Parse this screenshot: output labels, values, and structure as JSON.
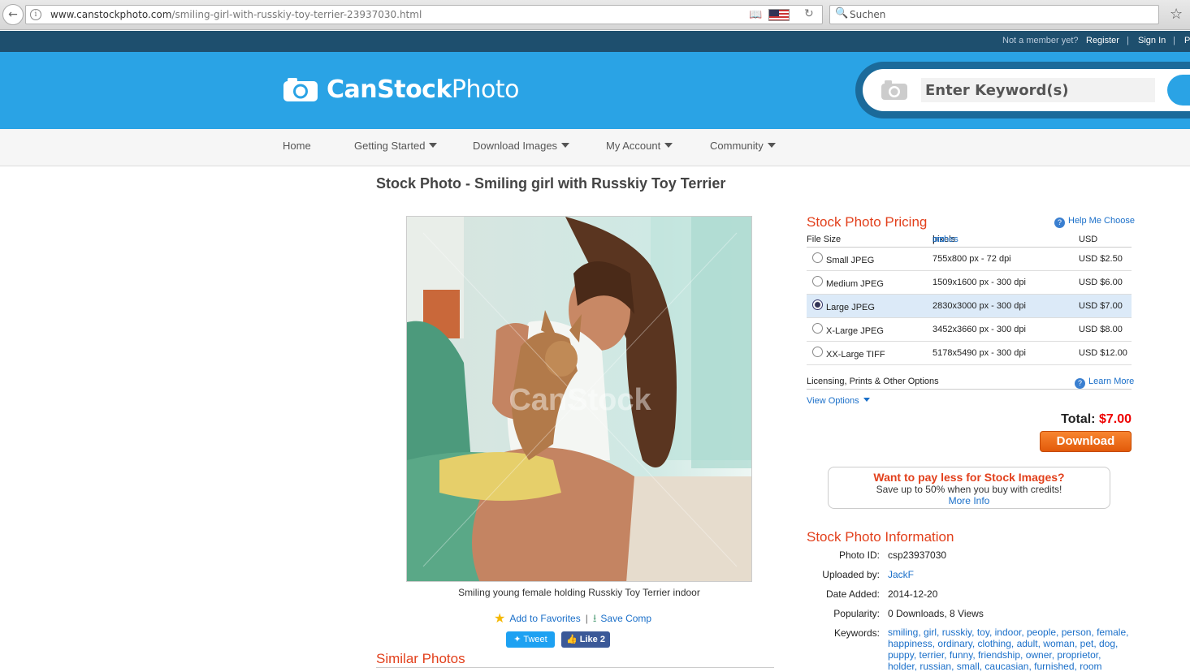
{
  "browser": {
    "url_host": "www.canstockphoto.com",
    "url_path": "/smiling-girl-with-russkiy-toy-terrier-23937030.html",
    "search_placeholder": "Suchen"
  },
  "member_bar": {
    "question": "Not a member yet?",
    "register": "Register",
    "sep": "|",
    "sign_in": "Sign In",
    "more": "P"
  },
  "header": {
    "logo_bold": "CanStock",
    "logo_light": "Photo",
    "keyword_placeholder": "Enter Keyword(s)"
  },
  "nav": {
    "items": [
      {
        "label": "Home"
      },
      {
        "label": "Getting Started"
      },
      {
        "label": "Download Images"
      },
      {
        "label": "My Account"
      },
      {
        "label": "Community"
      }
    ]
  },
  "page": {
    "title": "Stock Photo - Smiling girl with Russkiy Toy Terrier",
    "caption": "Smiling young female holding Russkiy Toy Terrier indoor",
    "watermark": "CanStock",
    "add_favorites": "Add to Favorites",
    "actions_sep": "|",
    "save_comp": "Save Comp",
    "tweet": "Tweet",
    "like": "Like 2",
    "similar_title": "Similar Photos"
  },
  "pricing": {
    "title": "Stock Photo Pricing",
    "help": "Help Me Choose",
    "col_file_size": "File Size",
    "col_pixels": "pixels",
    "col_inches": "inches",
    "col_cm": "cm",
    "col_sep": "|",
    "col_usd": "USD",
    "rows": [
      {
        "name": "Small JPEG",
        "size": "755x800 px - 72 dpi",
        "price": "USD $2.50"
      },
      {
        "name": "Medium JPEG",
        "size": "1509x1600 px - 300 dpi",
        "price": "USD $6.00"
      },
      {
        "name": "Large JPEG",
        "size": "2830x3000 px - 300 dpi",
        "price": "USD $7.00"
      },
      {
        "name": "X-Large JPEG",
        "size": "3452x3660 px - 300 dpi",
        "price": "USD $8.00"
      },
      {
        "name": "XX-Large TIFF",
        "size": "5178x5490 px - 300 dpi",
        "price": "USD $12.00"
      }
    ],
    "selected": "Large JPEG",
    "licensing": "Licensing, Prints & Other Options",
    "learn_more": "Learn More",
    "view_options": "View Options",
    "total_label": "Total:",
    "total_value": "$7.00",
    "download": "Download",
    "promo_title": "Want to pay less for Stock Images?",
    "promo_sub": "Save up to 50% when you buy with credits!",
    "promo_link": "More Info"
  },
  "info": {
    "title": "Stock Photo Information",
    "photo_id_label": "Photo ID:",
    "photo_id": "csp23937030",
    "uploaded_label": "Uploaded by:",
    "uploaded_by": "JackF",
    "date_label": "Date Added:",
    "date_added": "2014-12-20",
    "popularity_label": "Popularity:",
    "popularity": "0 Downloads, 8 Views",
    "keywords_label": "Keywords:",
    "keywords": [
      "smiling",
      "girl",
      "russkiy",
      "toy",
      "indoor",
      "people",
      "person",
      "female",
      "happiness",
      "ordinary",
      "clothing",
      "adult",
      "woman",
      "pet",
      "dog",
      "puppy",
      "terrier",
      "funny",
      "friendship",
      "owner",
      "proprietor",
      "holder",
      "russian",
      "small",
      "caucasian",
      "furnished",
      "room"
    ]
  },
  "colors": {
    "header_blue": "#2aa3e5",
    "accent_red": "#e2401c",
    "link_blue": "#1a6fc9",
    "download_orange": "#f07020"
  }
}
